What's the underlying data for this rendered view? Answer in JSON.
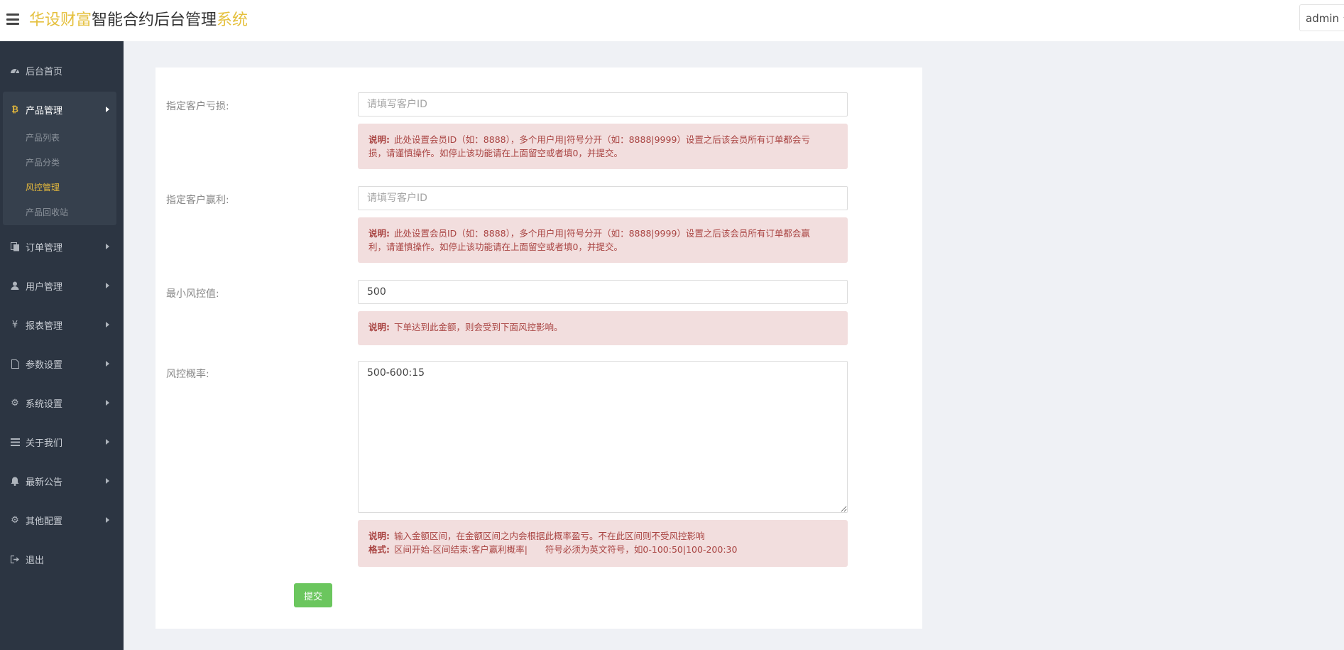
{
  "header": {
    "brand_a": "华设财富",
    "brand_b": "智能合约后台管理",
    "brand_c": "系统",
    "user": "admin"
  },
  "sidebar": {
    "items": [
      {
        "label": "后台首页",
        "icon": "dashboard-icon"
      },
      {
        "label": "产品管理",
        "icon": "bitcoin-icon"
      },
      {
        "label": "订单管理",
        "icon": "copy-icon"
      },
      {
        "label": "用户管理",
        "icon": "user-icon"
      },
      {
        "label": "报表管理",
        "icon": "yen-icon"
      },
      {
        "label": "参数设置",
        "icon": "file-icon"
      },
      {
        "label": "系统设置",
        "icon": "cogs-icon"
      },
      {
        "label": "关于我们",
        "icon": "list-icon"
      },
      {
        "label": "最新公告",
        "icon": "bell-icon"
      },
      {
        "label": "其他配置",
        "icon": "gear-icon"
      },
      {
        "label": "退出",
        "icon": "sign-out-icon"
      }
    ],
    "submenu": [
      "产品列表",
      "产品分类",
      "风控管理",
      "产品回收站"
    ]
  },
  "form": {
    "loss_label": "指定客户亏损:",
    "loss_placeholder": "请填写客户ID",
    "loss_note_title": "说明:",
    "loss_note_line1": "此处设置会员ID（如：8888），多个用户用|符号分开（如：8888|9999）设置之后该会员所有订单都会亏",
    "loss_note_line2": "损，请谨慎操作。如停止该功能请在上面留空或者填0，并提交。",
    "profit_label": "指定客户赢利:",
    "profit_placeholder": "请填写客户ID",
    "profit_note_title": "说明:",
    "profit_note_line1": "此处设置会员ID（如：8888），多个用户用|符号分开（如：8888|9999）设置之后该会员所有订单都会赢",
    "profit_note_line2": "利，请谨慎操作。如停止该功能请在上面留空或者填0，并提交。",
    "min_label": "最小风控值:",
    "min_value": "500",
    "min_note_title": "说明:",
    "min_note": "下单达到此金额，则会受到下面风控影响。",
    "rate_label": "风控概率:",
    "rate_value": "500-600:15",
    "rate_note_title": "说明:",
    "rate_note": "输入金额区间，在金额区间之内会根据此概率盈亏。不在此区间则不受风控影响",
    "rate_format_title": "格式:",
    "rate_format": "区间开始-区间结束:客户赢利概率|　　符号必须为英文符号，如0-100:50|100-200:30",
    "submit": "提交"
  }
}
